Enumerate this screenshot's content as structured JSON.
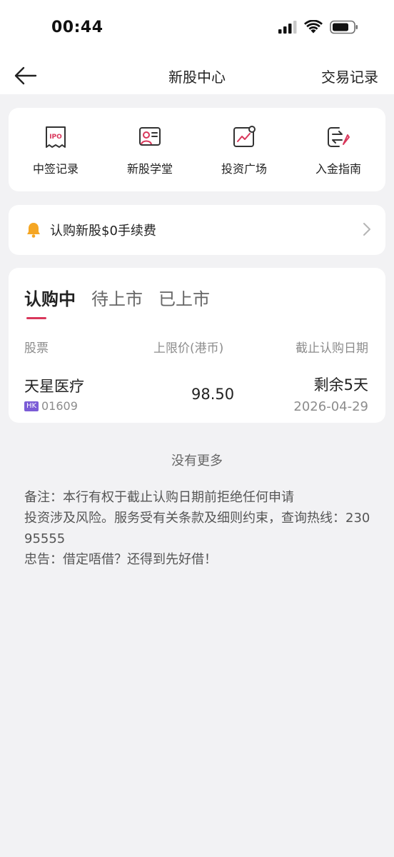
{
  "status": {
    "time": "00:44"
  },
  "nav": {
    "title": "新股中心",
    "right_label": "交易记录"
  },
  "quick_actions": [
    {
      "label": "中签记录",
      "icon": "ipo-ticket-icon"
    },
    {
      "label": "新股学堂",
      "icon": "classroom-icon"
    },
    {
      "label": "投资广场",
      "icon": "chart-plaza-icon"
    },
    {
      "label": "入金指南",
      "icon": "deposit-guide-icon"
    }
  ],
  "promo": {
    "text": "认购新股$0手续费",
    "icon": "bell-icon"
  },
  "tabs": [
    {
      "label": "认购中",
      "active": true
    },
    {
      "label": "待上市",
      "active": false
    },
    {
      "label": "已上市",
      "active": false
    }
  ],
  "table": {
    "headers": {
      "stock": "股票",
      "price": "上限价(港币)",
      "deadline": "截止认购日期"
    },
    "rows": [
      {
        "name": "天星医疗",
        "market": "HK",
        "code": "01609",
        "price": "98.50",
        "remaining": "剩余5天",
        "deadline": "2026-04-29"
      }
    ]
  },
  "no_more": "没有更多",
  "notes": [
    "备注：本行有权于截止认购日期前拒绝任何申请",
    "投资涉及风险。服务受有关条款及细则约束，查询热线：230 95555",
    "忠告：借定唔借？还得到先好借！"
  ],
  "colors": {
    "accent": "#d9375b",
    "hk_tag": "#7b5cd6",
    "bell": "#f5a623"
  }
}
